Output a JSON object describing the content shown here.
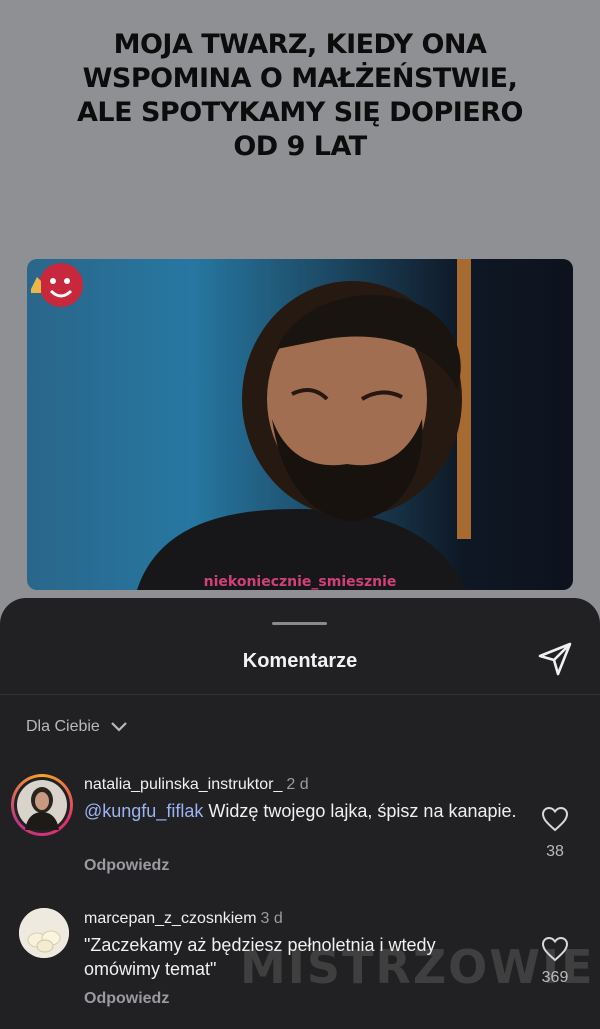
{
  "meme": {
    "title": "MOJA TWARZ, KIEDY ONA\nWSPOMINA O MAŁŻEŃSTWIE,\nALE SPOTYKAMY SIĘ DOPIERO\nOD 9 LAT",
    "image_watermark": "niekoniecznie_smiesznie"
  },
  "sheet": {
    "title": "Komentarze",
    "filter_label": "Dla Ciebie"
  },
  "comments": [
    {
      "username": "natalia_pulinska_instruktor_",
      "time": "2 d",
      "mention": "@kungfu_fiflak",
      "text": " Widzę twojego lajka, śpisz na kanapie.",
      "reply_label": "Odpowiedz",
      "likes": "38"
    },
    {
      "username": "marcepan_z_czosnkiem",
      "time": "3 d",
      "mention": "",
      "text": "\"Zaczekamy aż będziesz pełnoletnia i wtedy omówimy temat\"",
      "reply_label": "Odpowiedz",
      "likes": "369"
    }
  ],
  "watermark": "MISTRZOWIE",
  "colors": {
    "background_gray": "#8e9093",
    "sheet_bg": "#212123",
    "mention": "#9db2f2"
  },
  "icons": [
    "chevron-down-icon",
    "send-icon",
    "heart-icon"
  ]
}
